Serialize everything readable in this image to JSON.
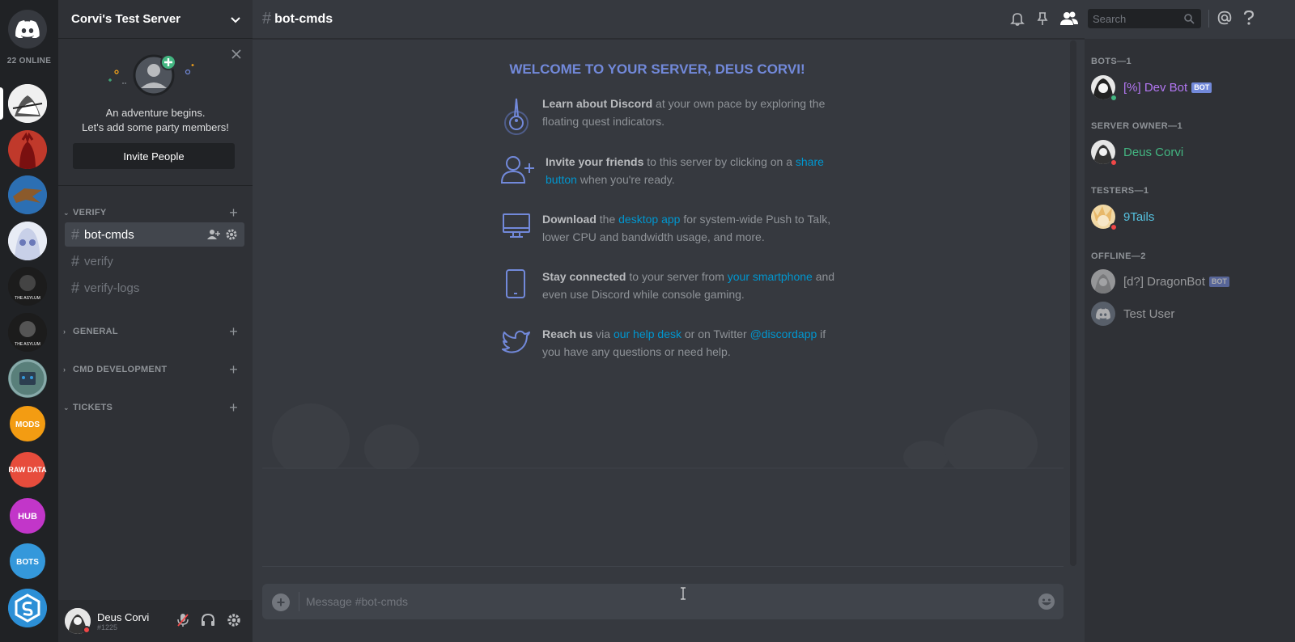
{
  "guilds": {
    "online_count": "22 ONLINE",
    "items": [
      {
        "name": "server-1"
      },
      {
        "name": "server-2"
      },
      {
        "name": "server-3"
      },
      {
        "name": "server-4"
      },
      {
        "name": "the-asylum-1",
        "label": "THE ASYLUM"
      },
      {
        "name": "the-asylum-2",
        "label": "THE ASYLUM"
      },
      {
        "name": "server-robot"
      },
      {
        "name": "mods",
        "label": "MODS"
      },
      {
        "name": "raw-data",
        "label": "RAW DATA"
      },
      {
        "name": "hub",
        "label": "HUB"
      },
      {
        "name": "bots",
        "label": "BOTS"
      },
      {
        "name": "server-s"
      }
    ],
    "colors": {
      "red": "#c0392b",
      "blue": "#2c6fb3",
      "orange": "#f39c12",
      "rawdata": "#e74c3c",
      "hub": "#c236c9",
      "bots": "#3498db",
      "shield": "#2c8fd6"
    }
  },
  "server": {
    "name": "Corvi's Test Server",
    "invite": {
      "line1": "An adventure begins.",
      "line2": "Let's add some party members!",
      "button": "Invite People"
    },
    "categories": [
      {
        "label": "VERIFY"
      },
      {
        "label": "GENERAL"
      },
      {
        "label": "CMD DEVELOPMENT"
      },
      {
        "label": "TICKETS"
      }
    ],
    "channels": [
      {
        "label": "bot-cmds"
      },
      {
        "label": "verify"
      },
      {
        "label": "verify-logs"
      }
    ]
  },
  "user": {
    "name": "Deus Corvi",
    "tag": "#1225",
    "status_color": "#f04747"
  },
  "chat": {
    "channel": "bot-cmds",
    "welcome": "WELCOME TO YOUR SERVER, DEUS CORVI!",
    "tips": [
      {
        "b": "Learn about Discord",
        "t1": " at your own pace by exploring the floating quest indicators.",
        "icon": "quest-icon"
      },
      {
        "b": "Invite your friends",
        "t1": " to this server by clicking on a ",
        "link": "share button",
        "t2": " when you're ready.",
        "icon": "add-user-icon"
      },
      {
        "b": "Download",
        "t1": " the ",
        "link": "desktop app",
        "t2": " for system-wide Push to Talk, lower CPU and bandwidth usage, and more.",
        "icon": "monitor-icon"
      },
      {
        "b": "Stay connected",
        "t1": " to your server from ",
        "link": "your smartphone",
        "t2": " and even use Discord while console gaming.",
        "icon": "phone-icon"
      },
      {
        "b": "Reach us",
        "t1": " via ",
        "link": "our help desk",
        "t2": " or on Twitter ",
        "link2": "@discordapp",
        "t3": " if you have any questions or need help.",
        "icon": "twitter-icon"
      }
    ],
    "placeholder": "Message #bot-cmds"
  },
  "header": {
    "search_placeholder": "Search"
  },
  "members": {
    "groups": [
      {
        "title": "BOTS—1",
        "members": [
          {
            "name": "[%] Dev Bot",
            "bot": "BOT",
            "color": "#b377f3",
            "status": "#43b581"
          }
        ]
      },
      {
        "title": "SERVER OWNER—1",
        "members": [
          {
            "name": "Deus Corvi",
            "color": "#43b581",
            "status": "#f04747"
          }
        ]
      },
      {
        "title": "TESTERS—1",
        "members": [
          {
            "name": "9Tails",
            "color": "#55c2e0",
            "status": "#f04747"
          }
        ]
      },
      {
        "title": "OFFLINE—2",
        "members": [
          {
            "name": "[d?] DragonBot",
            "bot": "BOT",
            "color": "#8e9297"
          },
          {
            "name": "Test User",
            "color": "#8e9297"
          }
        ]
      }
    ]
  }
}
